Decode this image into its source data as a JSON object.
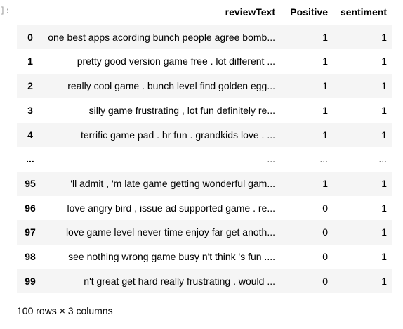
{
  "prompt_fragment": "]:",
  "table": {
    "columns": [
      "reviewText",
      "Positive",
      "sentiment"
    ],
    "rows": [
      {
        "index": "0",
        "reviewText": "one best apps acording bunch people agree bomb...",
        "Positive": "1",
        "sentiment": "1"
      },
      {
        "index": "1",
        "reviewText": "pretty good version game free . lot different ...",
        "Positive": "1",
        "sentiment": "1"
      },
      {
        "index": "2",
        "reviewText": "really cool game . bunch level find golden egg...",
        "Positive": "1",
        "sentiment": "1"
      },
      {
        "index": "3",
        "reviewText": "silly game frustrating , lot fun definitely re...",
        "Positive": "1",
        "sentiment": "1"
      },
      {
        "index": "4",
        "reviewText": "terrific game pad . hr fun . grandkids love . ...",
        "Positive": "1",
        "sentiment": "1"
      },
      {
        "index": "...",
        "reviewText": "...",
        "Positive": "...",
        "sentiment": "..."
      },
      {
        "index": "95",
        "reviewText": "'ll admit , 'm late game getting wonderful gam...",
        "Positive": "1",
        "sentiment": "1"
      },
      {
        "index": "96",
        "reviewText": "love angry bird , issue ad supported game . re...",
        "Positive": "0",
        "sentiment": "1"
      },
      {
        "index": "97",
        "reviewText": "love game level never time enjoy far get anoth...",
        "Positive": "0",
        "sentiment": "1"
      },
      {
        "index": "98",
        "reviewText": "see nothing wrong game busy n't think 's fun ....",
        "Positive": "0",
        "sentiment": "1"
      },
      {
        "index": "99",
        "reviewText": "n't great get hard really frustrating . would ...",
        "Positive": "0",
        "sentiment": "1"
      }
    ]
  },
  "footer": "100 rows × 3 columns"
}
